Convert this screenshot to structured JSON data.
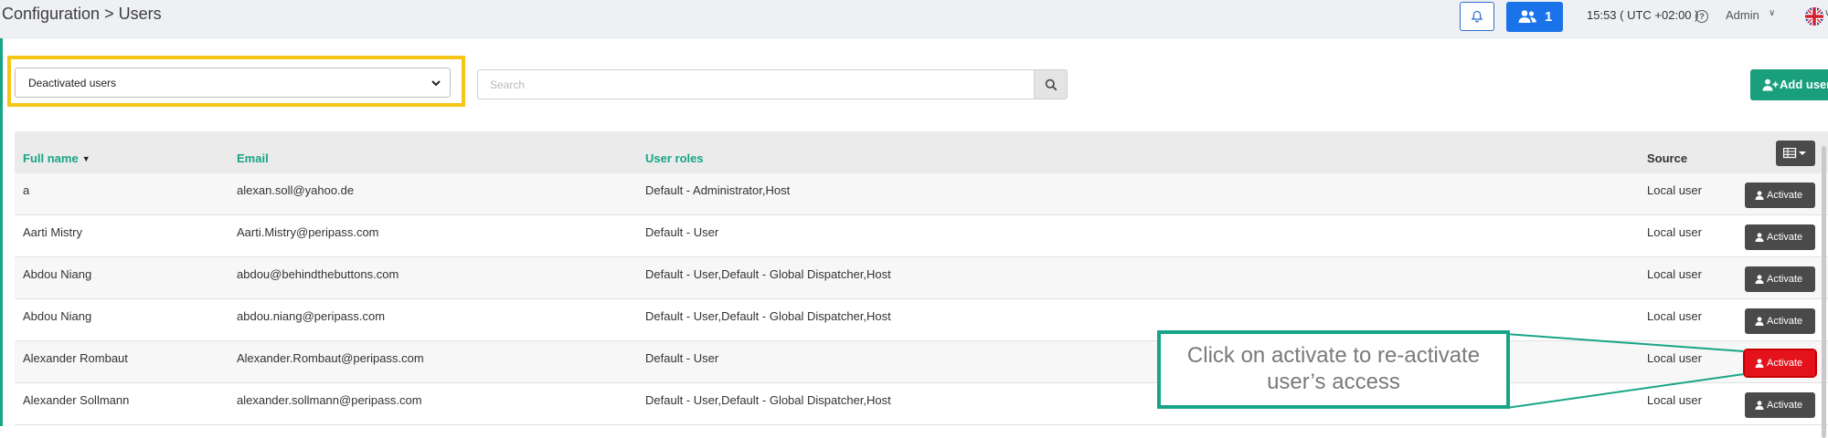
{
  "header": {
    "breadcrumb": "Configuration > Users",
    "notifications_count": "1",
    "clock": "15:53 ( UTC +02:00 )",
    "user": "Admin"
  },
  "toolbar": {
    "filter_value": "Deactivated users",
    "search_placeholder": "Search",
    "add_user_label": "Add user"
  },
  "table": {
    "columns": {
      "full_name": "Full name",
      "email": "Email",
      "roles": "User roles",
      "source": "Source"
    },
    "action_label": "Activate",
    "rows": [
      {
        "name": "a",
        "email": "alexan.soll@yahoo.de",
        "roles": "Default - Administrator,Host",
        "source": "Local user"
      },
      {
        "name": "Aarti Mistry",
        "email": "Aarti.Mistry@peripass.com",
        "roles": "Default - User",
        "source": "Local user"
      },
      {
        "name": "Abdou Niang",
        "email": "abdou@behindthebuttons.com",
        "roles": "Default - User,Default - Global Dispatcher,Host",
        "source": "Local user"
      },
      {
        "name": "Abdou Niang",
        "email": "abdou.niang@peripass.com",
        "roles": "Default - User,Default - Global Dispatcher,Host",
        "source": "Local user"
      },
      {
        "name": "Alexander Rombaut",
        "email": "Alexander.Rombaut@peripass.com",
        "roles": "Default - User",
        "source": "Local user"
      },
      {
        "name": "Alexander Sollmann",
        "email": "alexander.sollmann@peripass.com",
        "roles": "Default - User,Default - Global Dispatcher,Host",
        "source": "Local user"
      }
    ]
  },
  "callout": {
    "line1": "Click on activate to re-activate",
    "line2": "user’s access"
  },
  "colors": {
    "accent": "#18a587",
    "primary": "#1a73e8",
    "highlight_frame": "#f5c518",
    "highlight_button": "#e3121b"
  }
}
